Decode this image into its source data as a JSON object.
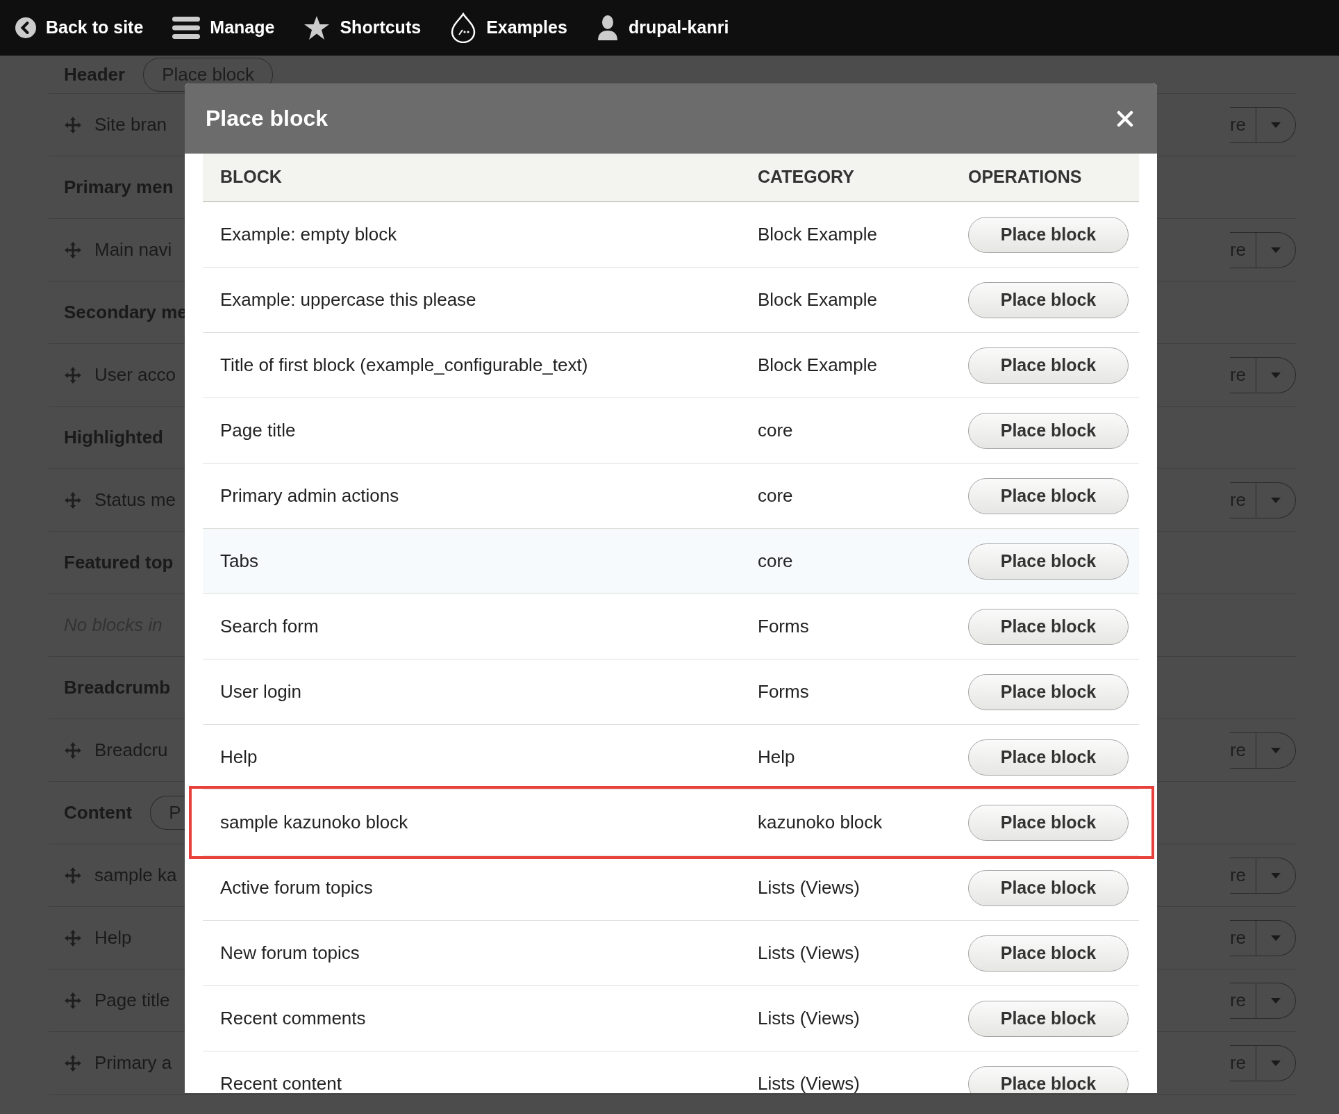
{
  "toolbar": {
    "items": [
      {
        "label": "Back to site"
      },
      {
        "label": "Manage"
      },
      {
        "label": "Shortcuts"
      },
      {
        "label": "Examples"
      },
      {
        "label": "drupal-kanri"
      }
    ]
  },
  "page": {
    "rows": [
      {
        "kind": "region",
        "label": "Header",
        "button": "Place block"
      },
      {
        "kind": "block",
        "label": "Site bran",
        "operation": "re"
      },
      {
        "kind": "region",
        "label": "Primary men"
      },
      {
        "kind": "block",
        "label": "Main navi",
        "operation": "re"
      },
      {
        "kind": "region",
        "label": "Secondary me"
      },
      {
        "kind": "block",
        "label": "User acco",
        "operation": "re"
      },
      {
        "kind": "region",
        "label": "Highlighted"
      },
      {
        "kind": "block",
        "label": "Status me",
        "operation": "re"
      },
      {
        "kind": "region",
        "label": "Featured top"
      },
      {
        "kind": "empty",
        "label": "No blocks in"
      },
      {
        "kind": "region",
        "label": "Breadcrumb"
      },
      {
        "kind": "block",
        "label": "Breadcru",
        "operation": "re"
      },
      {
        "kind": "region",
        "label": "Content",
        "button": "P"
      },
      {
        "kind": "block",
        "label": "sample ka",
        "operation": "re"
      },
      {
        "kind": "block",
        "label": "Help",
        "operation": "re"
      },
      {
        "kind": "block",
        "label": "Page title",
        "operation": "re"
      },
      {
        "kind": "block",
        "label": "Primary a",
        "operation": "re"
      }
    ]
  },
  "dialog": {
    "title": "Place block",
    "table": {
      "columns": [
        "BLOCK",
        "CATEGORY",
        "OPERATIONS"
      ],
      "rows": [
        {
          "block": "Example: empty block",
          "category": "Block Example",
          "operation": "Place block",
          "hovered": false,
          "outlined": false
        },
        {
          "block": "Example: uppercase this please",
          "category": "Block Example",
          "operation": "Place block",
          "hovered": false,
          "outlined": false
        },
        {
          "block": "Title of first block (example_configurable_text)",
          "category": "Block Example",
          "operation": "Place block",
          "hovered": false,
          "outlined": false
        },
        {
          "block": "Page title",
          "category": "core",
          "operation": "Place block",
          "hovered": false,
          "outlined": false
        },
        {
          "block": "Primary admin actions",
          "category": "core",
          "operation": "Place block",
          "hovered": false,
          "outlined": false
        },
        {
          "block": "Tabs",
          "category": "core",
          "operation": "Place block",
          "hovered": true,
          "outlined": false
        },
        {
          "block": "Search form",
          "category": "Forms",
          "operation": "Place block",
          "hovered": false,
          "outlined": false
        },
        {
          "block": "User login",
          "category": "Forms",
          "operation": "Place block",
          "hovered": false,
          "outlined": false
        },
        {
          "block": "Help",
          "category": "Help",
          "operation": "Place block",
          "hovered": false,
          "outlined": false
        },
        {
          "block": "sample kazunoko block",
          "category": "kazunoko block",
          "operation": "Place block",
          "hovered": false,
          "outlined": true
        },
        {
          "block": "Active forum topics",
          "category": "Lists (Views)",
          "operation": "Place block",
          "hovered": false,
          "outlined": false
        },
        {
          "block": "New forum topics",
          "category": "Lists (Views)",
          "operation": "Place block",
          "hovered": false,
          "outlined": false
        },
        {
          "block": "Recent comments",
          "category": "Lists (Views)",
          "operation": "Place block",
          "hovered": false,
          "outlined": false
        },
        {
          "block": "Recent content",
          "category": "Lists (Views)",
          "operation": "Place block",
          "hovered": false,
          "outlined": false
        }
      ]
    }
  }
}
